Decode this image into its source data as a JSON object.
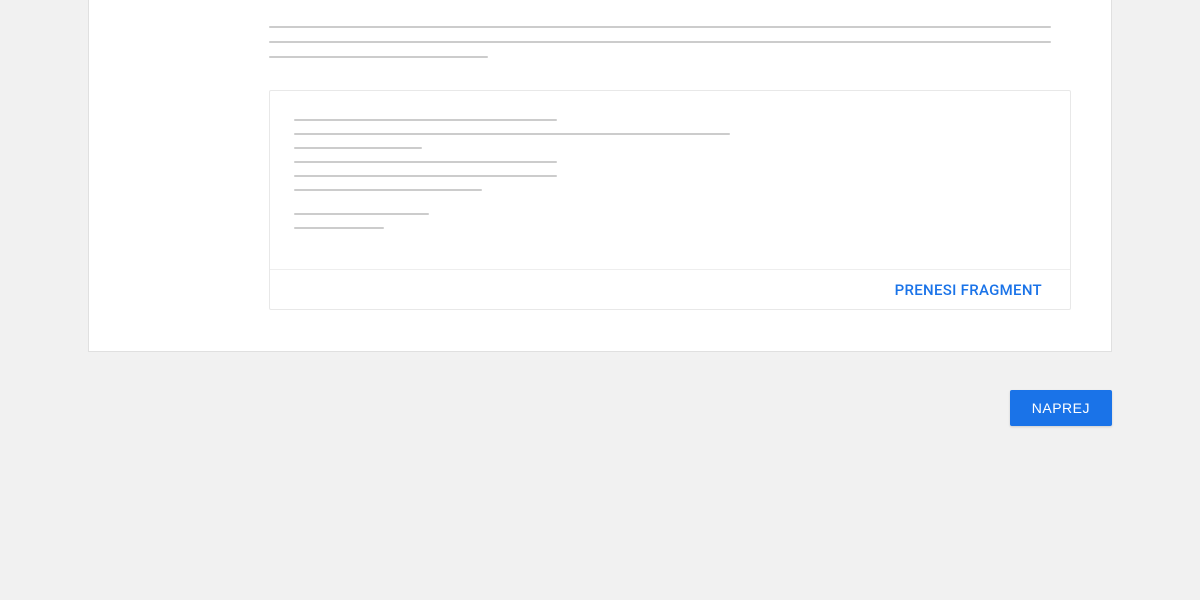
{
  "card": {
    "download_label": "PRENESI FRAGMENT"
  },
  "actions": {
    "next_label": "NAPREJ"
  },
  "placeholders": {
    "description_line_widths": [
      "100%",
      "100%",
      "28%"
    ],
    "code_line_widths": [
      "35%",
      "58%",
      "17%",
      "35%",
      "35%",
      "25%"
    ],
    "code_line_widths_group2": [
      "18%",
      "12%"
    ]
  }
}
